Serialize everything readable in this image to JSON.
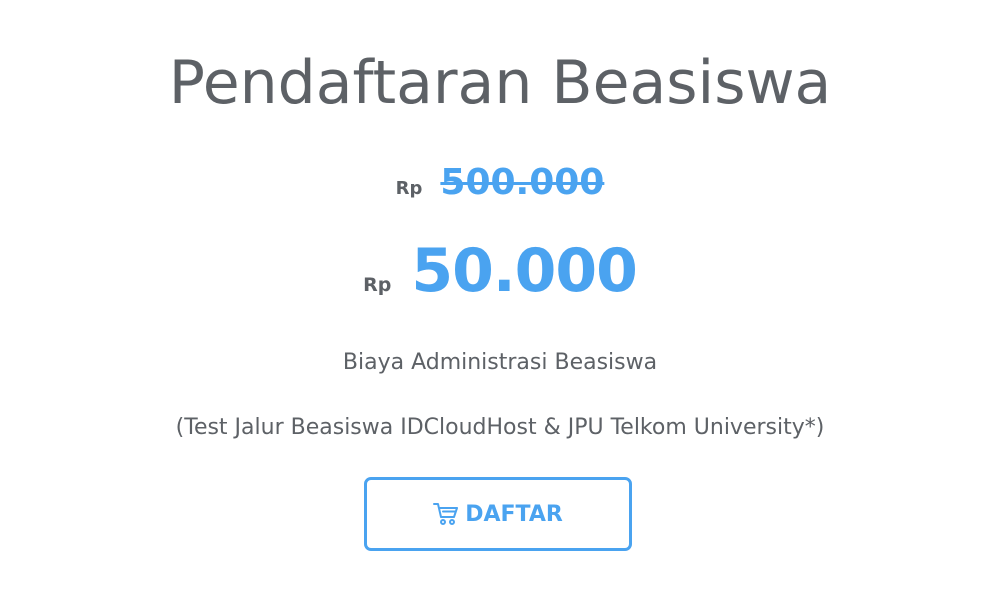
{
  "page": {
    "title": "Pendaftaran Beasiswa"
  },
  "pricing": {
    "old_currency": "Rp",
    "old_amount": "500.000",
    "new_currency": "Rp",
    "new_amount": "50.000"
  },
  "description": {
    "line1": "Biaya Administrasi Beasiswa",
    "line2": "(Test Jalur Beasiswa IDCloudHost & JPU Telkom University*)"
  },
  "cta": {
    "label": "DAFTAR",
    "icon": "cart-icon"
  },
  "colors": {
    "accent": "#4aa3f0",
    "text": "#5d6166",
    "background": "#ffffff"
  }
}
